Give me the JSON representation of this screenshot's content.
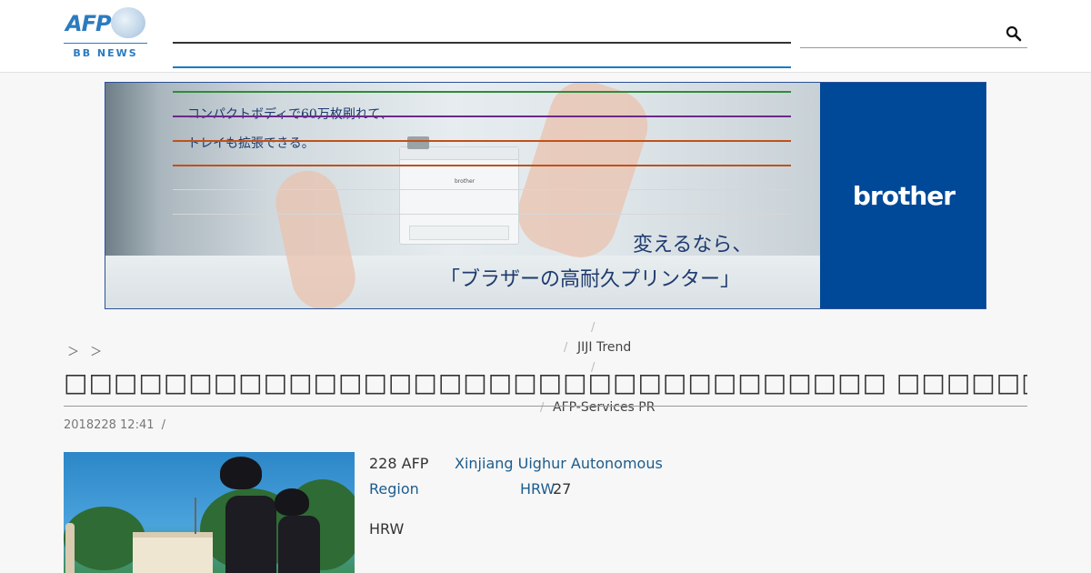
{
  "header": {
    "logo_text": "AFP",
    "logo_sub": "BB NEWS",
    "search_placeholder": "",
    "search_icon": "search-icon",
    "nav_lines": [
      "#333333",
      "#1a7cc0"
    ]
  },
  "ad": {
    "copy_line_1": "コンパクトボディで60万枚刷れて、",
    "copy_line_2": "トレイも拡張できる。",
    "headline_1": "変えるなら、",
    "headline_2": "「ブラザーの高耐久プリンター」",
    "brand": "brother",
    "printer_brand": "brother",
    "brand_color": "#004898",
    "stripe_colors": [
      "#2e8b3a",
      "#6a2a8a",
      "#c0521a",
      "#c0521a"
    ]
  },
  "breadcrumb": [
    "＞",
    "＞"
  ],
  "dropdown": {
    "links": [
      "JIJI Trend",
      "AFP-Services PR"
    ],
    "separator": "/"
  },
  "article": {
    "title": "□□□□□□□□□□□□□□□□□□□□□□□□□□□□□□□□□ □□□□□□□□",
    "date": "2018228 12:41",
    "date_sep": "/",
    "lead_1": "228 AFP",
    "link_1": "Xinjiang Uighur Autonomous",
    "link_2": "Region",
    "link_3": "HRW",
    "after_link_3": "27",
    "para_2": "HRW"
  }
}
